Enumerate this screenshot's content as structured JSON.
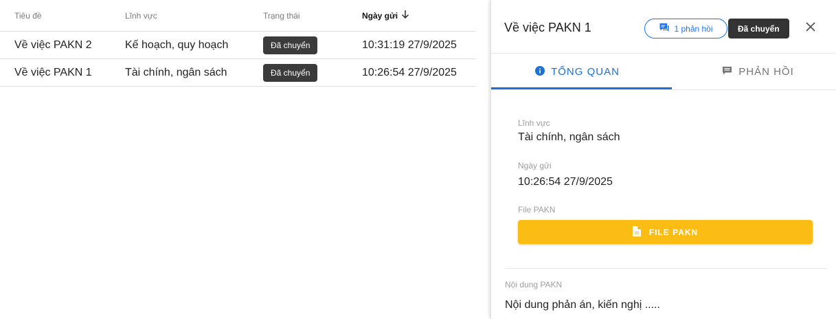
{
  "table": {
    "headers": {
      "title": "Tiêu đề",
      "field": "Lĩnh vực",
      "status": "Trạng thái",
      "sent_date": "Ngày gửi"
    },
    "sort_icon": "arrow-down-icon",
    "rows": [
      {
        "title": "Về việc PAKN 2",
        "field": "Kế hoạch, quy hoạch",
        "status": "Đã chuyển",
        "sent_date": "10:31:19 27/9/2025"
      },
      {
        "title": "Về việc PAKN 1",
        "field": "Tài chính, ngân sách",
        "status": "Đã chuyển",
        "sent_date": "10:26:54 27/9/2025"
      }
    ]
  },
  "panel": {
    "title": "Về việc PAKN 1",
    "reply_chip": "1 phản hồi",
    "status": "Đã chuyển",
    "tabs": [
      {
        "label": "TỔNG QUAN",
        "icon": "info-icon",
        "active": true
      },
      {
        "label": "PHẢN HỒI",
        "icon": "comment-icon",
        "active": false
      }
    ],
    "fields": {
      "field_label": "Lĩnh vực",
      "field_value": "Tài chính, ngân sách",
      "date_label": "Ngày gửi",
      "date_value": "10:26:54 27/9/2025",
      "file_label": "File PAKN",
      "file_button": "FILE PAKN",
      "content_label": "Nội dung PAKN",
      "content_value": "Nội dung phản án, kiến nghị ....."
    }
  },
  "colors": {
    "accent": "#1e6fd6",
    "status_chip": "#3b3b3b",
    "file_button": "#fbbd14"
  }
}
